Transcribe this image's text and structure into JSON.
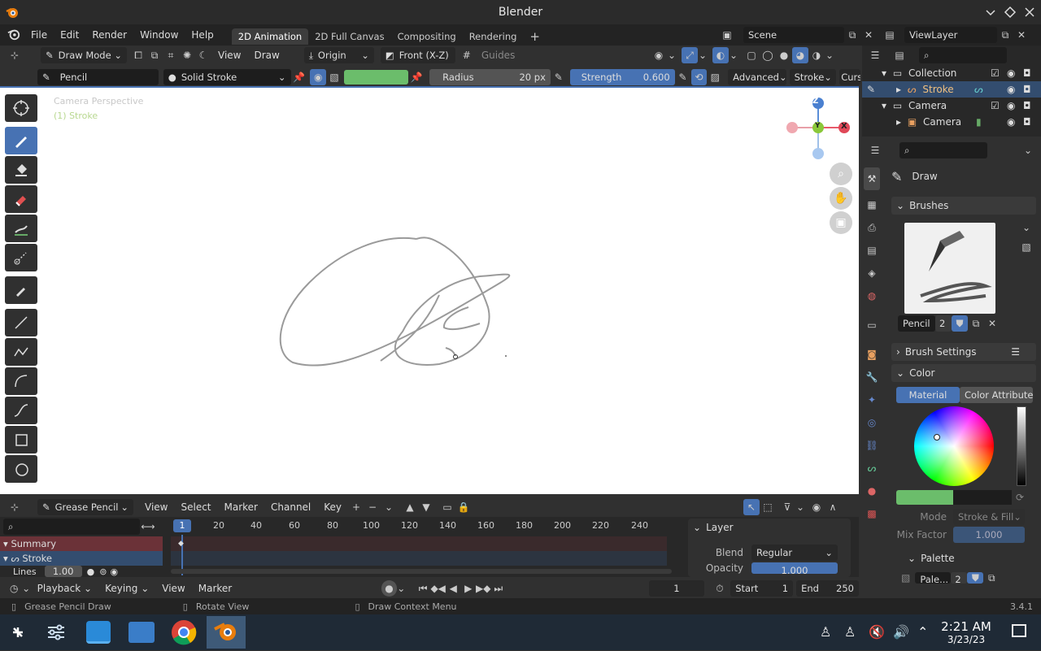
{
  "window": {
    "title": "Blender"
  },
  "menu": {
    "items": [
      "File",
      "Edit",
      "Render",
      "Window",
      "Help"
    ]
  },
  "workspaces": {
    "tabs": [
      "2D Animation",
      "2D Full Canvas",
      "Compositing",
      "Rendering"
    ],
    "add": "+"
  },
  "scene": {
    "name": "Scene",
    "viewlayer": "ViewLayer"
  },
  "header": {
    "mode": "Draw Mode",
    "view": "View",
    "draw": "Draw",
    "origin": "Origin",
    "front": "Front (X-Z)",
    "guides": "Guides"
  },
  "tool_settings": {
    "brush": "Pencil",
    "material": "Solid Stroke",
    "color": "#6bbd6b",
    "radius_label": "Radius",
    "radius_value": "20 px",
    "strength_label": "Strength",
    "strength_value": "0.600",
    "advanced": "Advanced",
    "stroke": "Stroke",
    "cursor": "Curs"
  },
  "viewport": {
    "overlay_title": "Camera Perspective",
    "overlay_object": "(1) Stroke",
    "gizmo": {
      "z": "Z",
      "y": "Y",
      "x": "X"
    }
  },
  "timeline": {
    "editor": "Grease Pencil",
    "menus": [
      "View",
      "Select",
      "Marker",
      "Channel",
      "Key"
    ],
    "frames": [
      "1",
      "20",
      "40",
      "60",
      "80",
      "100",
      "120",
      "140",
      "160",
      "180",
      "200",
      "220",
      "240"
    ],
    "current_frame": "1",
    "channels": {
      "summary": "Summary",
      "stroke": "Stroke",
      "lines": "Lines",
      "lines_value": "1.00"
    },
    "layer_panel": {
      "title": "Layer",
      "blend_label": "Blend",
      "blend_value": "Regular",
      "opacity_label": "Opacity",
      "opacity_value": "1.000"
    }
  },
  "playback": {
    "playback": "Playback",
    "keying": "Keying",
    "view": "View",
    "marker": "Marker",
    "frame": "1",
    "start_label": "Start",
    "start_value": "1",
    "end_label": "End",
    "end_value": "250"
  },
  "status": {
    "left": "Grease Pencil Draw",
    "middle": "Rotate View",
    "right": "Draw Context Menu",
    "version": "3.4.1"
  },
  "outliner": {
    "rows": [
      {
        "label": "Collection"
      },
      {
        "label": "Stroke"
      },
      {
        "label": "Camera"
      },
      {
        "label": "Camera"
      }
    ]
  },
  "properties": {
    "tool_name": "Draw",
    "brushes": "Brushes",
    "brush_name": "Pencil",
    "brush_users": "2",
    "brush_settings": "Brush Settings",
    "color": "Color",
    "material_tab": "Material",
    "color_attr_tab": "Color Attribute",
    "mode_label": "Mode",
    "mode_value": "Stroke & Fill",
    "mix_label": "Mix Factor",
    "mix_value": "1.000",
    "palette": "Palette",
    "palette_name": "Pale...",
    "palette_users": "2"
  },
  "taskbar": {
    "time": "2:21 AM",
    "date": "3/23/23"
  }
}
